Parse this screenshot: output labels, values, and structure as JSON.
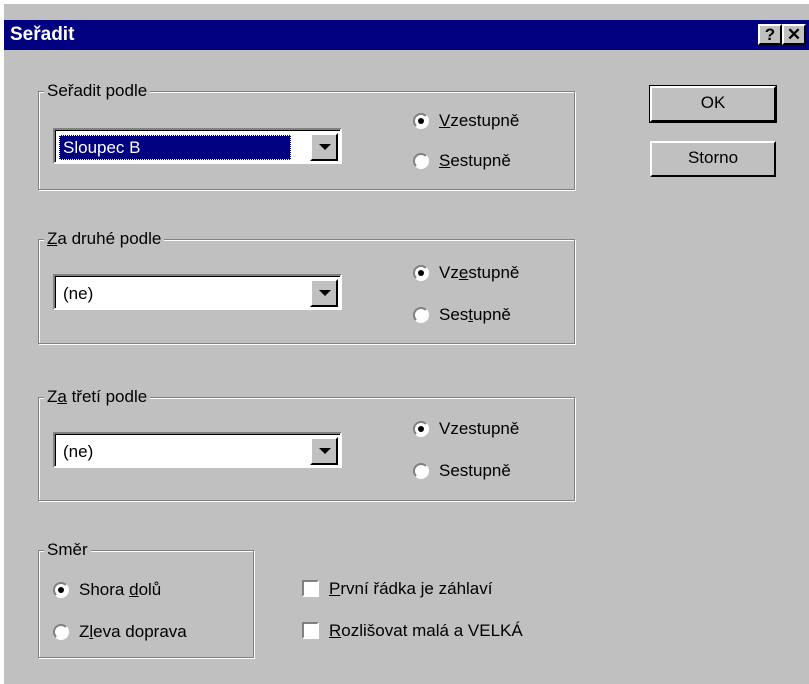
{
  "window": {
    "title": "Seřadit",
    "help_glyph": "?",
    "close_glyph": "✕"
  },
  "buttons": {
    "ok": "OK",
    "cancel": "Storno"
  },
  "sort1": {
    "legend_pre": "Seřadit podle",
    "legend_u": "",
    "legend_post": "",
    "value": "Sloupec B",
    "asc_pre": "",
    "asc_u": "V",
    "asc_post": "zestupně",
    "desc_pre": "",
    "desc_u": "S",
    "desc_post": "estupně",
    "selected": "asc"
  },
  "sort2": {
    "legend_pre": "",
    "legend_u": "Z",
    "legend_post": "a druhé podle",
    "value": "(ne)",
    "asc_pre": "Vz",
    "asc_u": "e",
    "asc_post": "stupně",
    "desc_pre": "Ses",
    "desc_u": "t",
    "desc_post": "upně",
    "selected": "asc"
  },
  "sort3": {
    "legend_pre": "Z",
    "legend_u": "a",
    "legend_post": " třetí podle",
    "value": "(ne)",
    "asc_pre": "Vzestupně",
    "asc_u": "",
    "asc_post": "",
    "desc_pre": "Sestupně",
    "desc_u": "",
    "desc_post": "",
    "selected": "asc"
  },
  "direction": {
    "legend": "Směr",
    "top_down_pre": "Shora ",
    "top_down_u": "d",
    "top_down_post": "olů",
    "left_right_pre": "Z",
    "left_right_u": "l",
    "left_right_post": "eva doprava",
    "selected": "top_down"
  },
  "options": {
    "header_u": "P",
    "header_post": "rvní řádka je záhlaví",
    "header_checked": false,
    "case_u": "R",
    "case_post": "ozlišovat malá a VELKÁ",
    "case_checked": false
  }
}
